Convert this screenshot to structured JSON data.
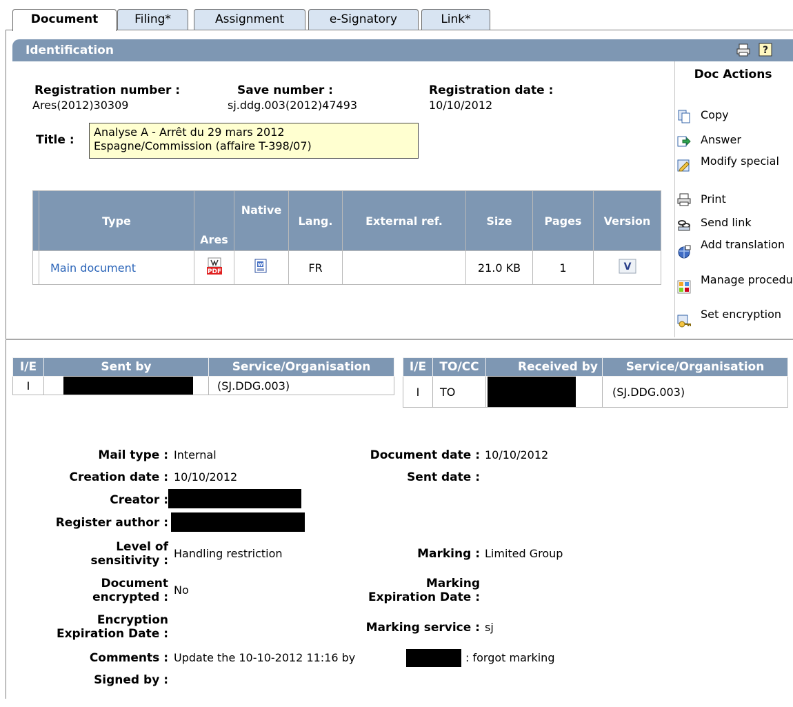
{
  "tabs": [
    "Document",
    "Filing*",
    "Assignment",
    "e-Signatory",
    "Link*"
  ],
  "identification": {
    "title": "Identification"
  },
  "doc_actions": {
    "title": "Doc Actions",
    "items": [
      {
        "label": "Copy",
        "icon": "copy-icon"
      },
      {
        "label": "Answer",
        "icon": "answer-icon"
      },
      {
        "label": "Modify special",
        "icon": "modify-special-icon"
      },
      {
        "label": "Print",
        "icon": "print-icon"
      },
      {
        "label": "Send link",
        "icon": "send-link-icon"
      },
      {
        "label": "Add translation",
        "icon": "add-translation-icon"
      },
      {
        "label": "Manage procedure",
        "icon": "manage-procedure-icon"
      },
      {
        "label": "Set encryption",
        "icon": "set-encryption-icon"
      }
    ]
  },
  "registration": {
    "number_label": "Registration number :",
    "number": "Ares(2012)30309",
    "save_label": "Save number :",
    "save": "sj.ddg.003(2012)47493",
    "date_label": "Registration date :",
    "date": "10/10/2012"
  },
  "title_field": {
    "label": "Title :",
    "line1": "Analyse A - Arrêt du 29 mars 2012",
    "line2": "Espagne/Commission (affaire T-398/07)"
  },
  "doc_table": {
    "headers": [
      "Type",
      "Ares",
      "Native",
      "Lang.",
      "External ref.",
      "Size",
      "Pages",
      "Version"
    ],
    "row": {
      "type": "Main document",
      "lang": "FR",
      "external_ref": "",
      "size": "21.0 KB",
      "pages": "1"
    }
  },
  "sent": {
    "headers": [
      "I/E",
      "Sent by",
      "Service/Organisation"
    ],
    "row": {
      "ie": "I",
      "service": "(SJ.DDG.003)"
    }
  },
  "received": {
    "headers": [
      "I/E",
      "TO/CC",
      "Received by",
      "Service/Organisation"
    ],
    "row": {
      "ie": "I",
      "tocc": "TO",
      "service": "(SJ.DDG.003)"
    }
  },
  "info": {
    "mail_type_label": "Mail type :",
    "mail_type": "Internal",
    "doc_date_label": "Document date :",
    "doc_date": "10/10/2012",
    "creation_label": "Creation date :",
    "creation": "10/10/2012",
    "sent_date_label": "Sent date :",
    "creator_label": "Creator :",
    "register_author_label": "Register author :",
    "sensitivity_label_1": "Level of",
    "sensitivity_label_2": "sensitivity :",
    "sensitivity": "Handling restriction",
    "marking_label": "Marking :",
    "marking": "Limited Group",
    "encrypted_label_1": "Document",
    "encrypted_label_2": "encrypted :",
    "encrypted": "No",
    "marking_exp_label_1": "Marking",
    "marking_exp_label_2": "Expiration Date :",
    "encryption_exp_label_1": "Encryption",
    "encryption_exp_label_2": "Expiration Date :",
    "marking_service_label": "Marking service :",
    "marking_service": "sj",
    "comments_label": "Comments :",
    "comments_prefix": "Update the 10-10-2012 11:16 by",
    "comments_suffix": ": forgot marking",
    "signed_by_label": "Signed by :"
  }
}
